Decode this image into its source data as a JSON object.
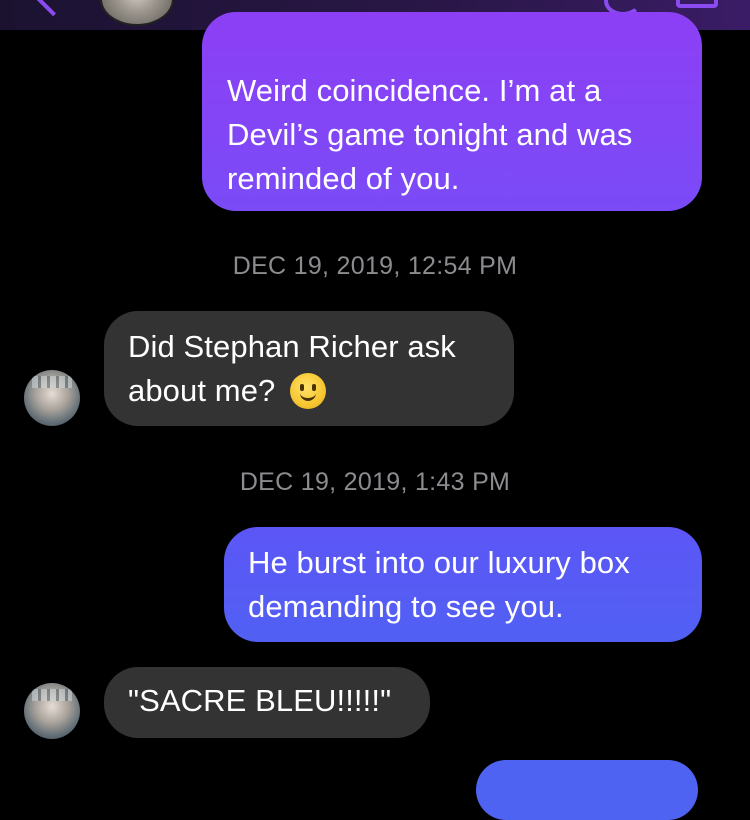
{
  "messages": [
    {
      "side": "sent",
      "lines": [
        "Weird coincidence. I’m at a",
        "Devil’s game tonight and was",
        "reminded of you."
      ]
    },
    {
      "side": "received",
      "lines": [
        "Did Stephan Richer ask",
        "about me?"
      ],
      "emoji": "slightly-smiling-face-icon"
    },
    {
      "side": "sent",
      "lines": [
        "He burst into our luxury box",
        "demanding to see you."
      ]
    },
    {
      "side": "received",
      "lines": [
        "\"SACRE BLEU!!!!!\""
      ]
    }
  ],
  "timestamps": [
    "DEC 19, 2019, 12:54 PM",
    "DEC 19, 2019, 1:43 PM"
  ],
  "colors": {
    "sent_bubble_top": "#8d3ff5",
    "sent_bubble_blue": "#5160f3",
    "received_bubble": "#333333",
    "timestamp": "#8c8c90",
    "background": "#000000"
  }
}
